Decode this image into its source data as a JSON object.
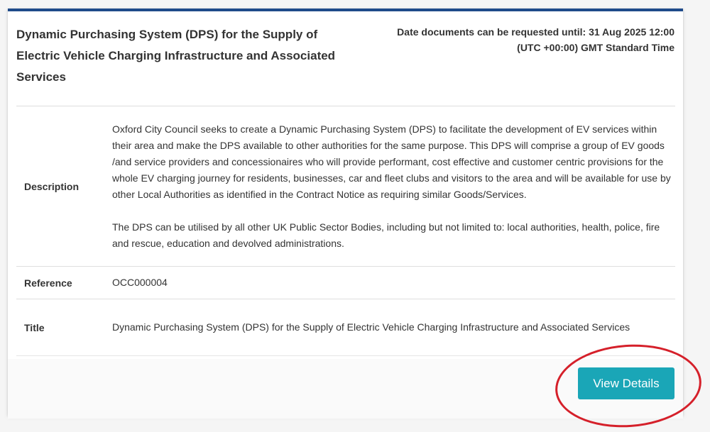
{
  "tender": {
    "title": "Dynamic Purchasing System (DPS) for the Supply of Electric Vehicle Charging Infrastructure and Associated Services",
    "deadline_line1": "Date documents can be requested until: 31 Aug 2025 12:00",
    "deadline_line2": "(UTC +00:00) GMT Standard Time"
  },
  "details": {
    "description_label": "Description",
    "description_p1": "Oxford City Council seeks to create a Dynamic Purchasing System (DPS) to facilitate the development of EV services within their area and make the DPS available to other authorities for the same purpose. This DPS will comprise a group of EV goods /and service providers and concessionaires who will provide performant, cost effective and customer centric provisions for the whole EV charging journey for residents, businesses, car and fleet clubs and visitors to the area and will be available for use by other Local Authorities as identified in the Contract Notice as requiring similar Goods/Services.",
    "description_p2": "The DPS can be utilised by all other UK Public Sector Bodies, including but not limited to: local authorities, health, police, fire and rescue, education and devolved administrations.",
    "reference_label": "Reference",
    "reference_value": "OCC000004",
    "title_label": "Title",
    "title_value": "Dynamic Purchasing System (DPS) for the Supply of Electric Vehicle Charging Infrastructure and Associated Services"
  },
  "actions": {
    "view_details_label": "View Details"
  },
  "colors": {
    "header_border": "#1f4b8a",
    "button": "#1aa6b7",
    "highlight_ring": "#d5202a"
  }
}
